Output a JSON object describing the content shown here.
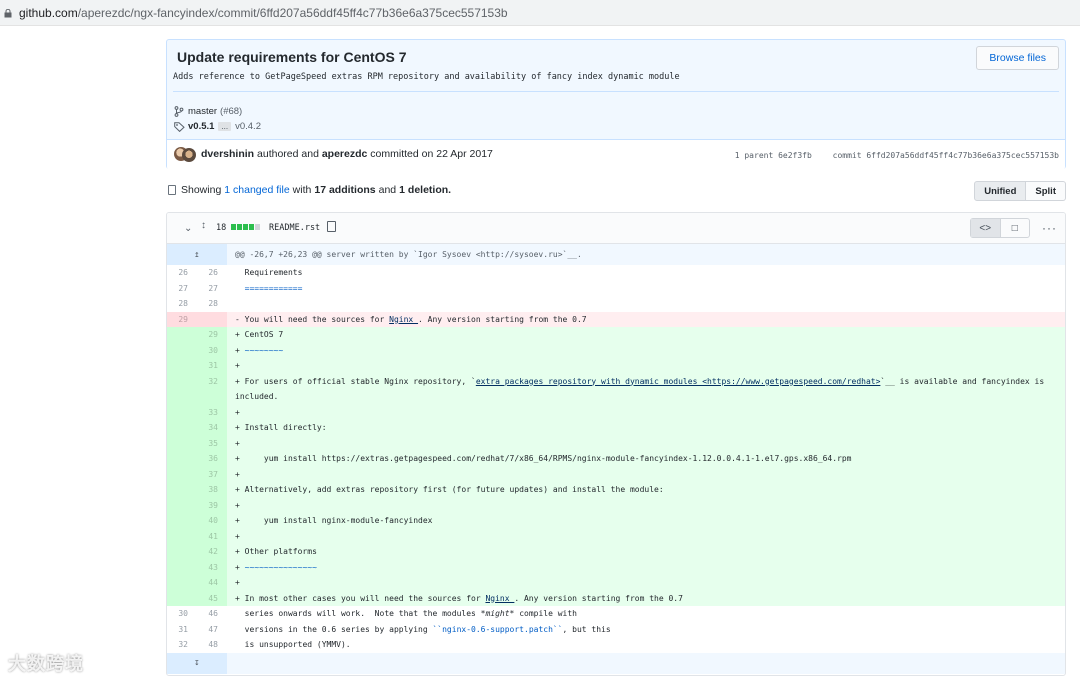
{
  "url": {
    "host": "github.com",
    "path": "/aperezdc/ngx-fancyindex/commit/6ffd207a56ddf45ff4c77b36e6a375cec557153b"
  },
  "commit": {
    "title": "Update requirements for CentOS 7",
    "description": "Adds reference to GetPageSpeed extras RPM repository and availability of fancy index dynamic module",
    "browse_label": "Browse files",
    "branch": "master",
    "pr": "(#68)",
    "tag_latest": "v0.5.1",
    "tag_ellipsis": "...",
    "tag_oldest": "v0.4.2",
    "author": "dvershinin",
    "authored_text": "authored and",
    "committer": "aperezdc",
    "committed_text": "committed on 22 Apr 2017",
    "parent_text": "1 parent 6e2f3fb",
    "commit_text": "commit 6ffd207a56ddf45ff4c77b36e6a375cec557153b"
  },
  "toolbar": {
    "showing": "Showing",
    "changed": "1 changed file",
    "with": "with",
    "additions": "17 additions",
    "and": "and",
    "deletions": "1 deletion.",
    "unified": "Unified",
    "split": "Split"
  },
  "file": {
    "changes": "18",
    "name": "README.rst",
    "diffstat": [
      "add",
      "add",
      "add",
      "add",
      "del"
    ],
    "hunk": "@@ -26,7 +26,23 @@ server written by `Igor Sysoev <http://sysoev.ru>`__."
  },
  "diff_lines": [
    {
      "type": "ctx",
      "old": "26",
      "new": "26",
      "text": "  Requirements"
    },
    {
      "type": "ctx",
      "old": "27",
      "new": "27",
      "text": "  ============",
      "style": "blue"
    },
    {
      "type": "ctx",
      "old": "28",
      "new": "28",
      "text": " "
    },
    {
      "type": "del",
      "old": "29",
      "new": "",
      "text": "- You will need the sources for ",
      "link": "Nginx_",
      "after": ". Any version starting from the 0.7"
    },
    {
      "type": "add",
      "old": "",
      "new": "29",
      "text": "+ CentOS 7"
    },
    {
      "type": "add",
      "old": "",
      "new": "30",
      "text": "+ ",
      "after_blue": "~~~~~~~~"
    },
    {
      "type": "add",
      "old": "",
      "new": "31",
      "text": "+"
    },
    {
      "type": "add",
      "old": "",
      "new": "32",
      "text": "+ For users of official stable Nginx repository, `",
      "link": "extra packages repository with dynamic modules <https://www.getpagespeed.com/redhat>",
      "after": "`__ is available and fancyindex is included.",
      "tall": true
    },
    {
      "type": "add",
      "old": "",
      "new": "33",
      "text": "+"
    },
    {
      "type": "add",
      "old": "",
      "new": "34",
      "text": "+ Install directly:"
    },
    {
      "type": "add",
      "old": "",
      "new": "35",
      "text": "+"
    },
    {
      "type": "add",
      "old": "",
      "new": "36",
      "text": "+     yum install https://extras.getpagespeed.com/redhat/7/x86_64/RPMS/nginx-module-fancyindex-1.12.0.0.4.1-1.el7.gps.x86_64.rpm"
    },
    {
      "type": "add",
      "old": "",
      "new": "37",
      "text": "+"
    },
    {
      "type": "add",
      "old": "",
      "new": "38",
      "text": "+ Alternatively, add extras repository first (for future updates) and install the module:"
    },
    {
      "type": "add",
      "old": "",
      "new": "39",
      "text": "+"
    },
    {
      "type": "add",
      "old": "",
      "new": "40",
      "text": "+     yum install nginx-module-fancyindex"
    },
    {
      "type": "add",
      "old": "",
      "new": "41",
      "text": "+"
    },
    {
      "type": "add",
      "old": "",
      "new": "42",
      "text": "+ Other platforms"
    },
    {
      "type": "add",
      "old": "",
      "new": "43",
      "text": "+ ",
      "after_blue": "~~~~~~~~~~~~~~~"
    },
    {
      "type": "add",
      "old": "",
      "new": "44",
      "text": "+"
    },
    {
      "type": "add",
      "old": "",
      "new": "45",
      "text": "+ In most other cases you will need the sources for ",
      "link": "Nginx_",
      "after": ". Any version starting from the 0.7"
    },
    {
      "type": "ctx",
      "old": "30",
      "new": "46",
      "text": "  series onwards will work.  Note that the modules ",
      "italic": "*might*",
      "after": " compile with"
    },
    {
      "type": "ctx",
      "old": "31",
      "new": "47",
      "text": "  versions in the 0.6 series by applying ",
      "code": "``nginx-0.6-support.patch``",
      "after": ", but this"
    },
    {
      "type": "ctx",
      "old": "32",
      "new": "48",
      "text": "  is unsupported (YMMV)."
    }
  ],
  "colors": {
    "add_block": "#2cbe4e",
    "del_block": "#d1d5da",
    "link": "#0366d6"
  },
  "watermark": "大数跨境"
}
